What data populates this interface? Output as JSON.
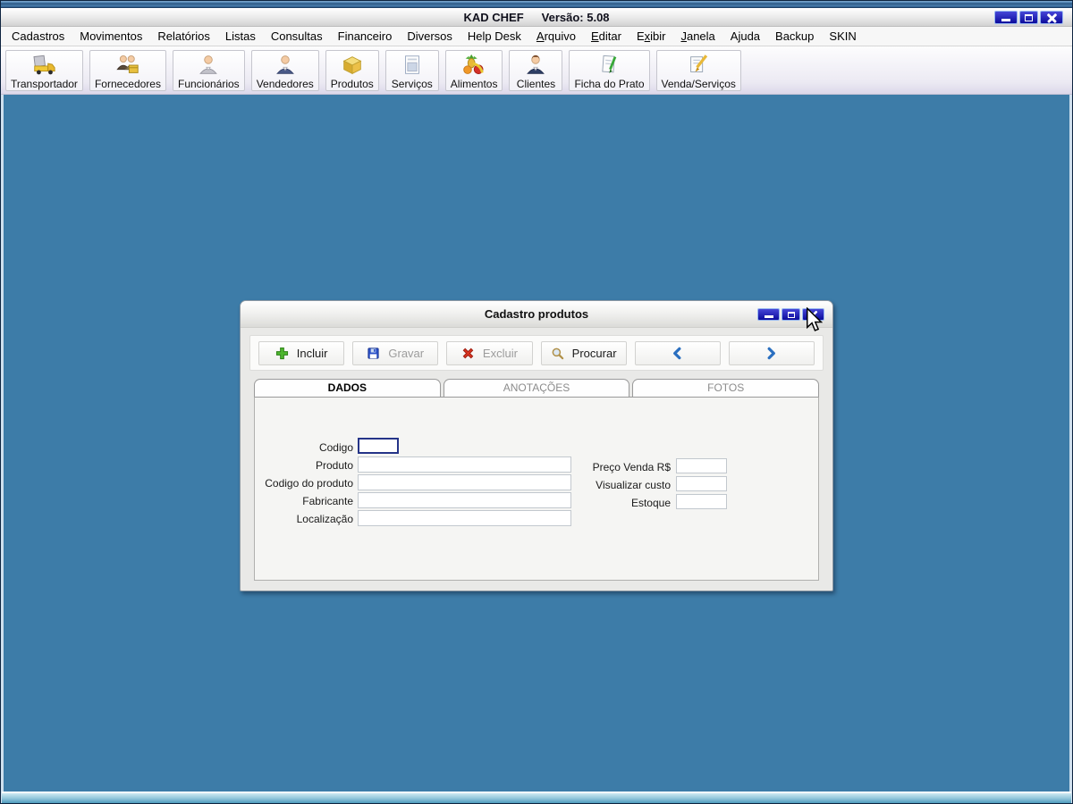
{
  "window": {
    "app_title": "KAD CHEF",
    "version": "Versão: 5.08"
  },
  "menu": {
    "items": [
      "Cadastros",
      "Movimentos",
      "Relatórios",
      "Listas",
      "Consultas",
      "Financeiro",
      "Diversos",
      "Help Desk",
      "Arquivo",
      "Editar",
      "Exibir",
      "Janela",
      "Ajuda",
      "Backup",
      "SKIN"
    ]
  },
  "toolbar": {
    "items": [
      {
        "label": "Transportador",
        "icon": "truck-icon"
      },
      {
        "label": "Fornecedores",
        "icon": "suppliers-icon"
      },
      {
        "label": "Funcionários",
        "icon": "employee-icon"
      },
      {
        "label": "Vendedores",
        "icon": "vendor-icon"
      },
      {
        "label": "Produtos",
        "icon": "product-box-icon"
      },
      {
        "label": "Serviços",
        "icon": "services-doc-icon"
      },
      {
        "label": "Alimentos",
        "icon": "foods-icon"
      },
      {
        "label": "Clientes",
        "icon": "client-icon"
      },
      {
        "label": "Ficha do Prato",
        "icon": "dish-sheet-icon"
      },
      {
        "label": "Venda/Serviços",
        "icon": "sale-pencil-icon"
      }
    ]
  },
  "dialog": {
    "title": "Cadastro produtos",
    "buttons": [
      {
        "label": "Incluir",
        "icon": "add-plus-icon",
        "enabled": true
      },
      {
        "label": "Gravar",
        "icon": "save-floppy-icon",
        "enabled": false
      },
      {
        "label": "Excluir",
        "icon": "delete-x-icon",
        "enabled": false
      },
      {
        "label": "Procurar",
        "icon": "search-magnifier-icon",
        "enabled": true
      },
      {
        "label": "",
        "icon": "prev-chevron-icon",
        "enabled": true
      },
      {
        "label": "",
        "icon": "next-chevron-icon",
        "enabled": true
      }
    ],
    "tabs": [
      {
        "label": "DADOS",
        "active": true
      },
      {
        "label": "ANOTAÇÕES",
        "active": false
      },
      {
        "label": "FOTOS",
        "active": false
      }
    ],
    "fields_left": [
      {
        "label": "Codigo",
        "value": ""
      },
      {
        "label": "Produto",
        "value": ""
      },
      {
        "label": "Codigo do produto",
        "value": ""
      },
      {
        "label": "Fabricante",
        "value": ""
      },
      {
        "label": "Localização",
        "value": ""
      }
    ],
    "fields_right": [
      {
        "label": "Preço Venda R$",
        "value": ""
      },
      {
        "label": "Visualizar custo",
        "value": ""
      },
      {
        "label": "Estoque",
        "value": ""
      }
    ]
  },
  "icons": {
    "window_controls": [
      "minimize-icon",
      "maximize-icon",
      "close-icon"
    ],
    "cursor": "arrow-cursor"
  },
  "colors": {
    "desktop": "#3d7ca8",
    "window_control_button": "#1010a4",
    "incluir_green": "#3fae2a",
    "excluir_red": "#d42818",
    "gravar_blue": "#2a50c8",
    "chevron_blue": "#2a6fc0",
    "focused_input_border": "#253488"
  }
}
